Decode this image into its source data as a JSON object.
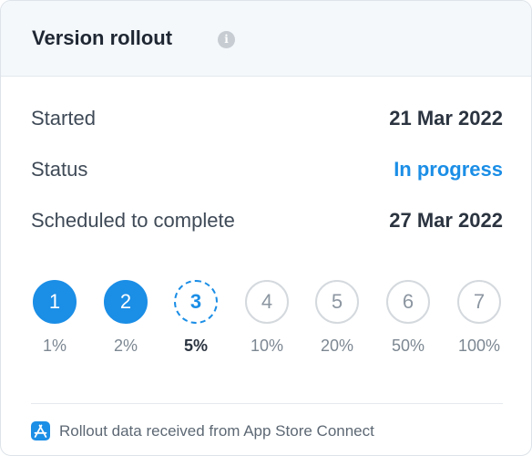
{
  "card": {
    "title": "Version rollout",
    "info_icon": "info-icon"
  },
  "details": [
    {
      "label": "Started",
      "value": "21 Mar 2022"
    },
    {
      "label": "Status",
      "value": "In progress"
    },
    {
      "label": "Scheduled to complete",
      "value": "27 Mar 2022"
    }
  ],
  "phases": [
    {
      "number": "1",
      "percent": "1%",
      "state": "completed"
    },
    {
      "number": "2",
      "percent": "2%",
      "state": "completed"
    },
    {
      "number": "3",
      "percent": "5%",
      "state": "current"
    },
    {
      "number": "4",
      "percent": "10%",
      "state": "pending"
    },
    {
      "number": "5",
      "percent": "20%",
      "state": "pending"
    },
    {
      "number": "6",
      "percent": "50%",
      "state": "pending"
    },
    {
      "number": "7",
      "percent": "100%",
      "state": "pending"
    }
  ],
  "footer": {
    "icon": "app-store-icon",
    "text": "Rollout data received from App Store Connect"
  },
  "colors": {
    "accent": "#1b8ee6",
    "header_bg": "#f4f8fb",
    "text_dark": "#2b3440",
    "text_muted": "#7c8792"
  }
}
